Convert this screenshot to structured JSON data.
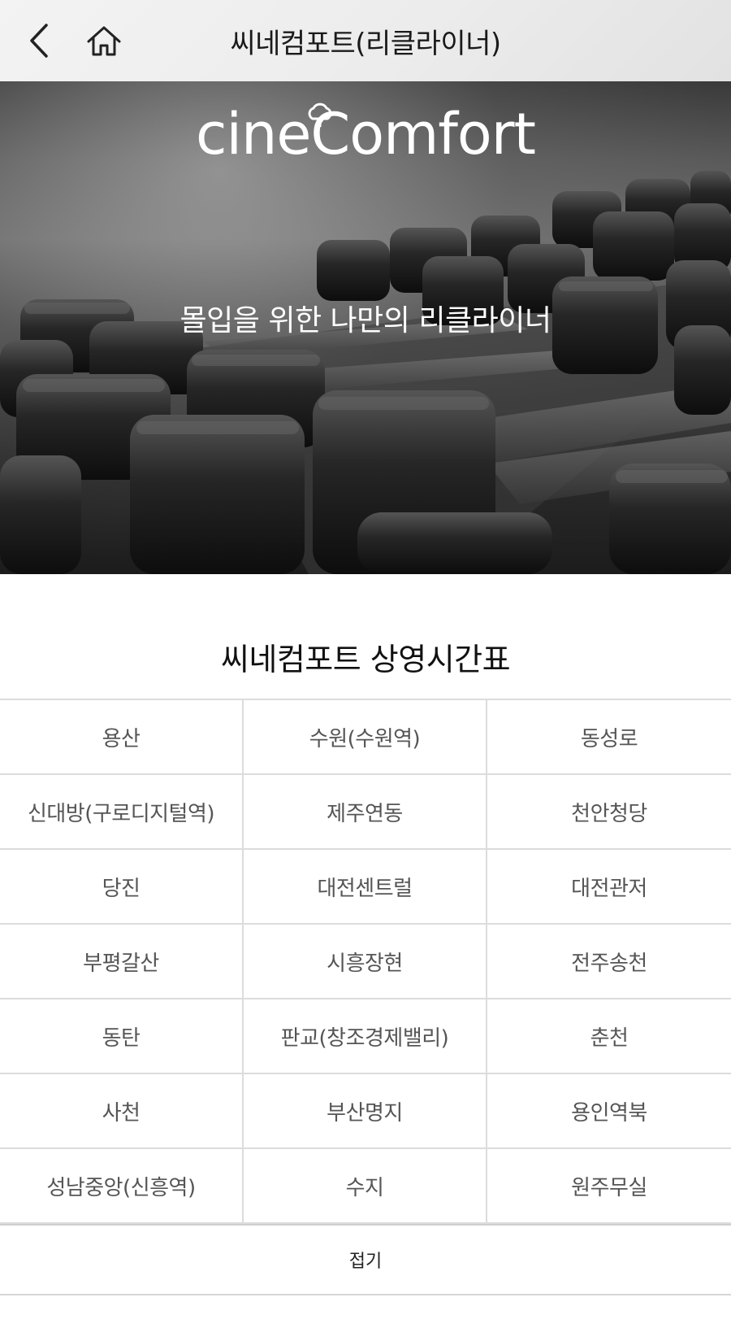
{
  "header": {
    "title": "씨네컴포트(리클라이너)",
    "back_icon": "chevron-left-icon",
    "home_icon": "home-icon"
  },
  "hero": {
    "brand": "cineComfort",
    "tagline": "몰입을 위한 나만의 리클라이너"
  },
  "schedule": {
    "title": "씨네컴포트 상영시간표",
    "theaters": [
      "용산",
      "수원(수원역)",
      "동성로",
      "신대방(구로디지털역)",
      "제주연동",
      "천안청당",
      "당진",
      "대전센트럴",
      "대전관저",
      "부평갈산",
      "시흥장현",
      "전주송천",
      "동탄",
      "판교(창조경제밸리)",
      "춘천",
      "사천",
      "부산명지",
      "용인역북",
      "성남중앙(신흥역)",
      "수지",
      "원주무실"
    ],
    "collapse_label": "접기"
  },
  "colors": {
    "header_bg": "#ececec",
    "grid_border": "#dcdcdc",
    "cell_text": "#555555"
  }
}
